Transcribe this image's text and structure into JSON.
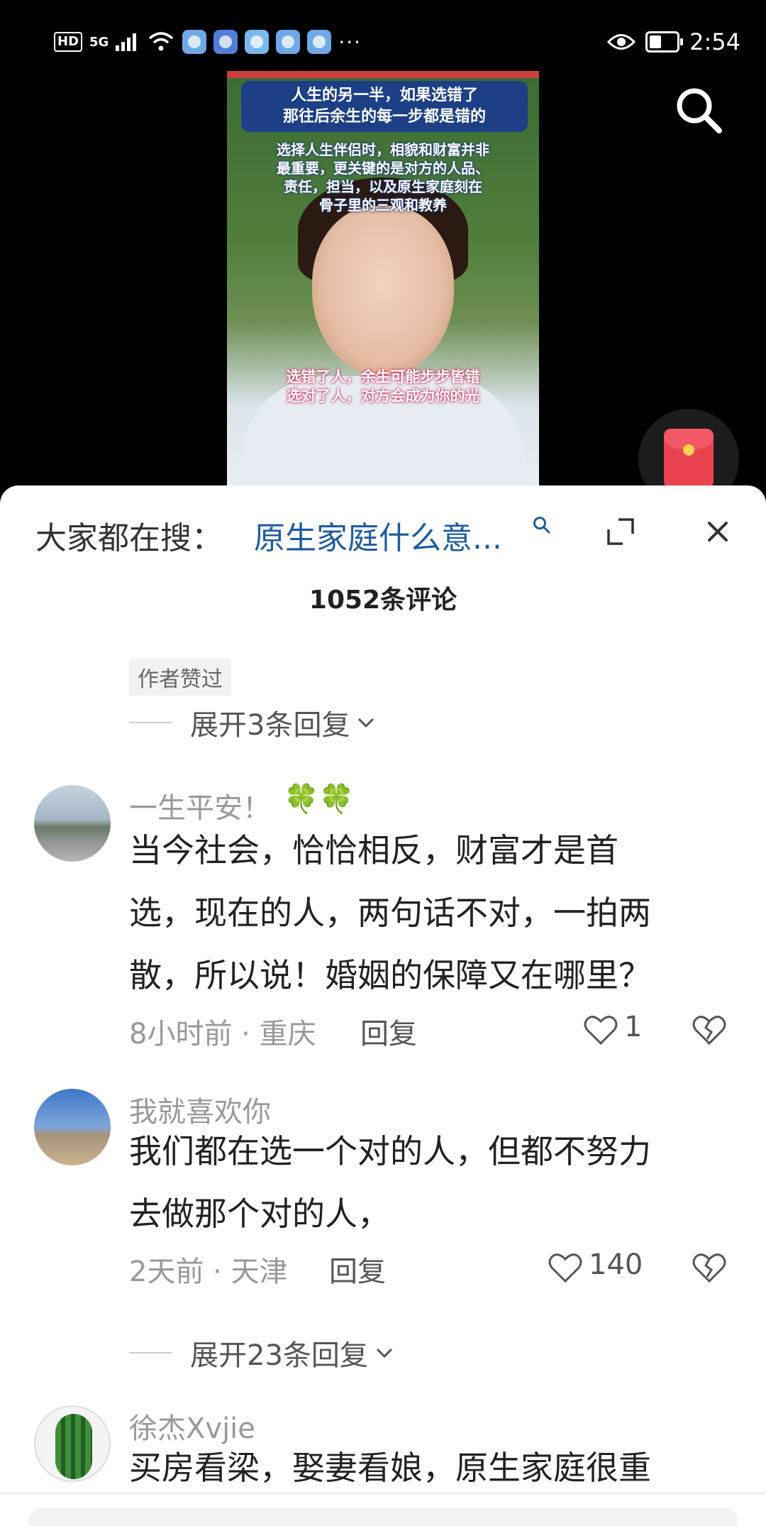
{
  "status_bar": {
    "hd": "HD",
    "network": "5G",
    "dots": "···",
    "time": "2:54"
  },
  "video": {
    "title_line1": "人生的另一半，如果选错了",
    "title_line2": "那往后余生的每一步都是错的",
    "body_line1": "选择人生伴侣时，相貌和财富并非",
    "body_line2": "最重要，更关键的是对方的人品、",
    "body_line3": "责任，担当，以及原生家庭刻在",
    "body_line4": "骨子里的三观和教养",
    "bottom_line1": "选错了人，余生可能步步皆错",
    "bottom_line2": "选对了人，对方会成为你的光"
  },
  "panel": {
    "search_prefix": "大家都在搜：",
    "search_term": "原生家庭什么意...",
    "comment_count": "1052条评论",
    "author_liked_tag": "作者赞过",
    "expand_replies_1": "展开3条回复",
    "expand_replies_2": "展开23条回复"
  },
  "comments": [
    {
      "username": "一生平安！",
      "clovers": "🍀🍀",
      "lines": [
        "当今社会，恰恰相反，财富才是首",
        "选，现在的人，两句话不对，一拍两",
        "散，所以说！婚姻的保障又在哪里？"
      ],
      "meta": "8小时前 · 重庆",
      "reply": "回复",
      "likes": "1"
    },
    {
      "username": "我就喜欢你",
      "lines": [
        "我们都在选一个对的人，但都不努力",
        "去做那个对的人，"
      ],
      "meta": "2天前 · 天津",
      "reply": "回复",
      "likes": "140"
    },
    {
      "username": "徐杰Xvjie",
      "lines": [
        "买房看梁，娶妻看娘，原生家庭很重"
      ]
    }
  ],
  "icons": {
    "search": "search-icon",
    "expand": "expand-icon",
    "close": "close-icon",
    "like": "heart-icon",
    "dislike": "broken-heart-icon",
    "redpacket": "red-packet-icon"
  },
  "colors": {
    "link_blue": "#1f5c9e",
    "muted": "#999999"
  }
}
